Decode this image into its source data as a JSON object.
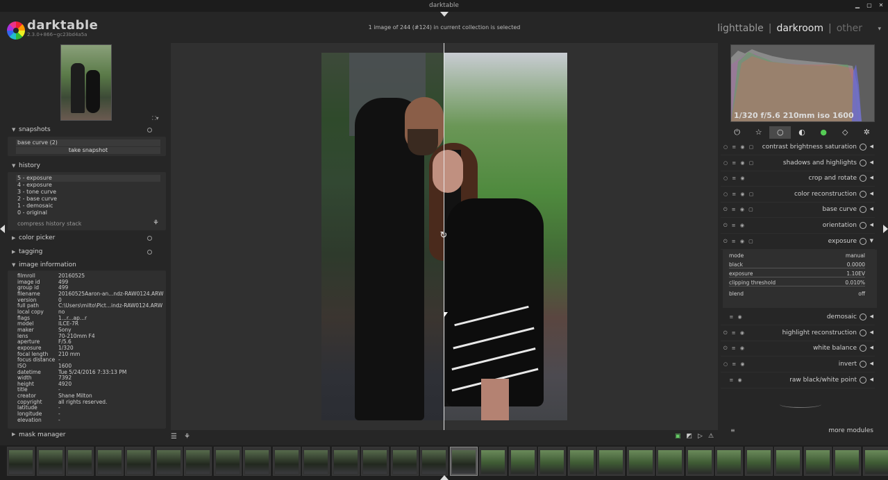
{
  "window": {
    "title": "darktable",
    "controls": [
      "minimize-icon",
      "maximize-icon",
      "close-icon"
    ]
  },
  "header": {
    "app_name": "darktable",
    "version": "2.3.0+866~gc23bd4a5a",
    "status": "1 image of 244 (#124) in current collection is selected",
    "views": {
      "lighttable": "lighttable",
      "darkroom": "darkroom",
      "other": "other",
      "separator": "|"
    },
    "view_dropdown": "▾"
  },
  "left": {
    "snapshots": {
      "title": "snapshots",
      "items": [
        "base curve (2)"
      ],
      "button": "take snapshot"
    },
    "history": {
      "title": "history",
      "items": [
        "5 - exposure",
        "4 - exposure",
        "3 - tone curve",
        "2 - base curve",
        "1 - demosaic",
        "0 - original"
      ],
      "compress": "compress history stack"
    },
    "color_picker": {
      "title": "color picker"
    },
    "tagging": {
      "title": "tagging"
    },
    "image_information": {
      "title": "image information",
      "rows": [
        [
          "filmroll",
          "20160525"
        ],
        [
          "image id",
          "499"
        ],
        [
          "group id",
          "499"
        ],
        [
          "filename",
          "20160525Aaron-an...ndz-RAW0124.ARW"
        ],
        [
          "version",
          "0"
        ],
        [
          "full path",
          "C:\\Users\\milto\\Pict...indz-RAW0124.ARW"
        ],
        [
          "local copy",
          "no"
        ],
        [
          "flags",
          "1...r...ap...r"
        ],
        [
          "model",
          "ILCE-7R"
        ],
        [
          "maker",
          "Sony"
        ],
        [
          "lens",
          "70-210mm F4"
        ],
        [
          "aperture",
          "F/5.6"
        ],
        [
          "exposure",
          "1/320"
        ],
        [
          "focal length",
          "210 mm"
        ],
        [
          "focus distance",
          "-"
        ],
        [
          "ISO",
          "1600"
        ],
        [
          "datetime",
          "Tue 5/24/2016 7:33:13 PM"
        ],
        [
          "width",
          "7392"
        ],
        [
          "height",
          "4920"
        ],
        [
          "title",
          "-"
        ],
        [
          "creator",
          "Shane Milton"
        ],
        [
          "copyright",
          "all rights reserved."
        ],
        [
          "latitude",
          "-"
        ],
        [
          "longitude",
          "-"
        ],
        [
          "elevation",
          "-"
        ]
      ]
    },
    "mask_manager": {
      "title": "mask manager"
    }
  },
  "right": {
    "histogram_info": "1/320 f/5.6 210mm iso 1600",
    "groups": [
      "⏻",
      "☆",
      "○",
      "◐",
      "●",
      "◇",
      "✲"
    ],
    "modules": [
      {
        "name": "contrast brightness saturation"
      },
      {
        "name": "shadows and highlights"
      },
      {
        "name": "crop and rotate"
      },
      {
        "name": "color reconstruction"
      },
      {
        "name": "base curve"
      },
      {
        "name": "orientation"
      },
      {
        "name": "exposure"
      },
      {
        "name": "demosaic"
      },
      {
        "name": "highlight reconstruction"
      },
      {
        "name": "white balance"
      },
      {
        "name": "invert"
      },
      {
        "name": "raw black/white point"
      }
    ],
    "exposure_params": {
      "mode_label": "mode",
      "mode_value": "manual",
      "black_label": "black",
      "black_value": "0.0000",
      "exposure_label": "exposure",
      "exposure_value": "1.10EV",
      "clipping_label": "clipping threshold",
      "clipping_value": "0.010%",
      "blend_label": "blend",
      "blend_value": "off"
    },
    "more_modules": "more modules"
  },
  "bottom": {
    "left_icons": [
      "☰",
      "⚘"
    ],
    "right_icons": [
      "▣",
      "◩",
      "▷",
      "⚠"
    ]
  },
  "filmstrip": {
    "count": 30,
    "current_index": 15
  }
}
